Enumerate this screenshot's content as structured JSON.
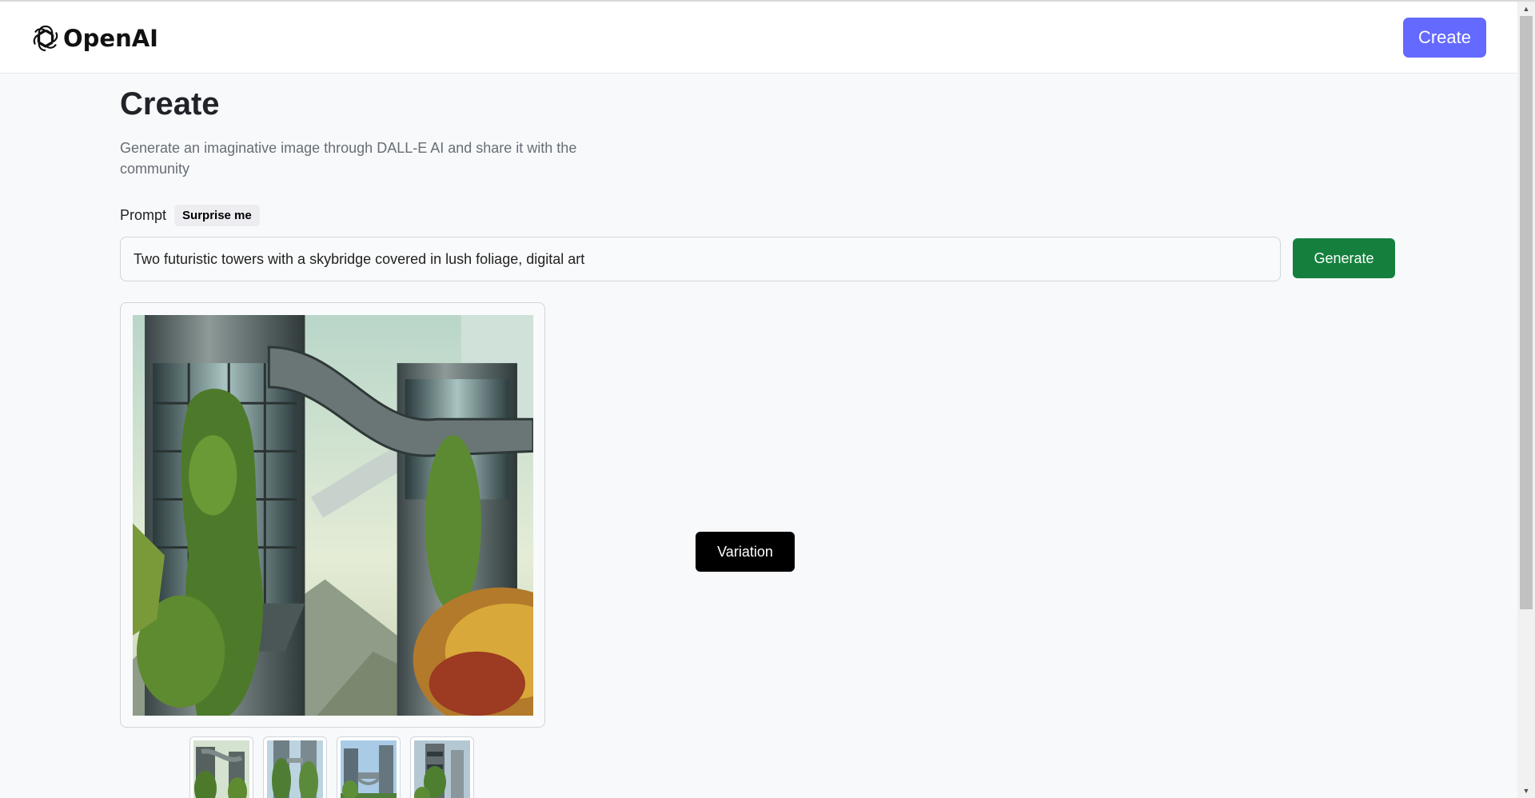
{
  "header": {
    "brand": "OpenAI",
    "create_label": "Create",
    "accent_color": "#6469ff"
  },
  "main": {
    "title": "Create",
    "subtitle": "Generate an imaginative image through DALL-E AI and share it with the community",
    "prompt_label": "Prompt",
    "surprise_label": "Surprise me",
    "prompt_value": "Two futuristic towers with a skybridge covered in lush foliage, digital art",
    "generate_label": "Generate",
    "generate_color": "#15803d",
    "variation_label": "Variation"
  },
  "icons": {
    "logo": "openai-logo-icon",
    "scroll_up": "scroll-up-arrow-icon",
    "scroll_down": "scroll-down-arrow-icon"
  }
}
